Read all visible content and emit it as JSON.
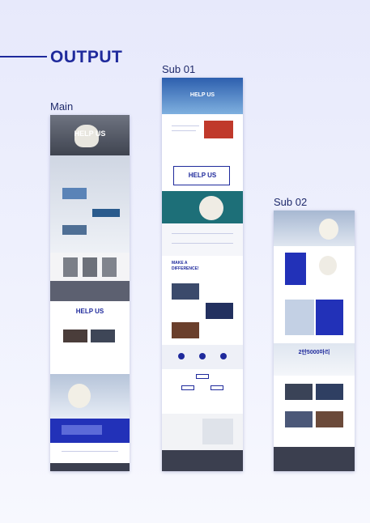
{
  "heading": "OUTPUT",
  "labels": {
    "main": "Main",
    "sub01": "Sub 01",
    "sub02": "Sub 02"
  },
  "main": {
    "hero_title": "HELP US",
    "section2_title": "HELP US"
  },
  "sub01": {
    "hero_title": "HELP US",
    "logo_text": "HELP US",
    "headline_1": "MAKE A",
    "headline_2": "DIFFERENCE!"
  },
  "sub02": {
    "headline_number": "2만5000마리"
  },
  "colors": {
    "accent": "#1f2a9c",
    "brand_blue": "#2231b8",
    "teal": "#1d6f78",
    "dark": "#3b3f4f"
  }
}
